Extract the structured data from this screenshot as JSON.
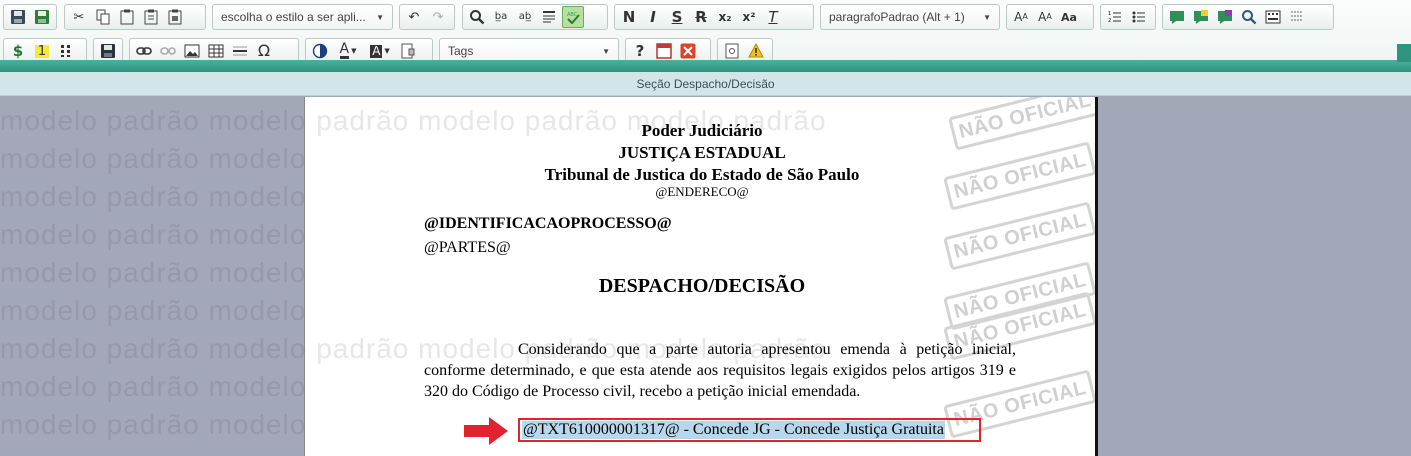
{
  "toolbar": {
    "row1": {
      "style_select": "escolha o estilo a ser apli...",
      "paragraph_select": "paragrafoPadrao (Alt + 1)",
      "bold": "N",
      "italic": "I",
      "strike": "S",
      "remove_format": "T",
      "subscript": "x₂",
      "superscript": "x²",
      "font_increase": "A",
      "font_decrease": "A",
      "case": "Aa"
    },
    "row2": {
      "currency": "$",
      "numbering": "1",
      "omega": "Ω",
      "tags_select": "Tags",
      "help": "?"
    }
  },
  "section_title": "Seção Despacho/Decisão",
  "watermark": {
    "side_text": "modelo padrão modelo padrão modelo padrão modelo padrão",
    "stamp_text": "NÃO OFICIAL"
  },
  "document": {
    "header1": "Poder Judiciário",
    "header2": "JUSTIÇA ESTADUAL",
    "header3": "Tribunal de Justica do Estado de São Paulo",
    "address": "@ENDERECO@",
    "process_id": "@IDENTIFICACAOPROCESSO@",
    "parties": "@PARTES@",
    "title": "DESPACHO/DECISÃO",
    "paragraph": "Considerando que a parte autoria apresentou emenda à petição inicial, conforme determinado, e que esta atende aos  requisitos legais exigidos pelos artigos 319 e 320 do Código de Processo civil, recebo a petição inicial emendada.",
    "highlighted": "@TXT610000001317@ - Concede JG - Concede Justiça Gratuita"
  },
  "colors": {
    "toolbar_band": "#2e9480",
    "section_bar": "#d2e6ea",
    "highlight_border": "#e0232f",
    "highlight_fill": "#b7d7ec",
    "arrow": "#e0232f"
  }
}
